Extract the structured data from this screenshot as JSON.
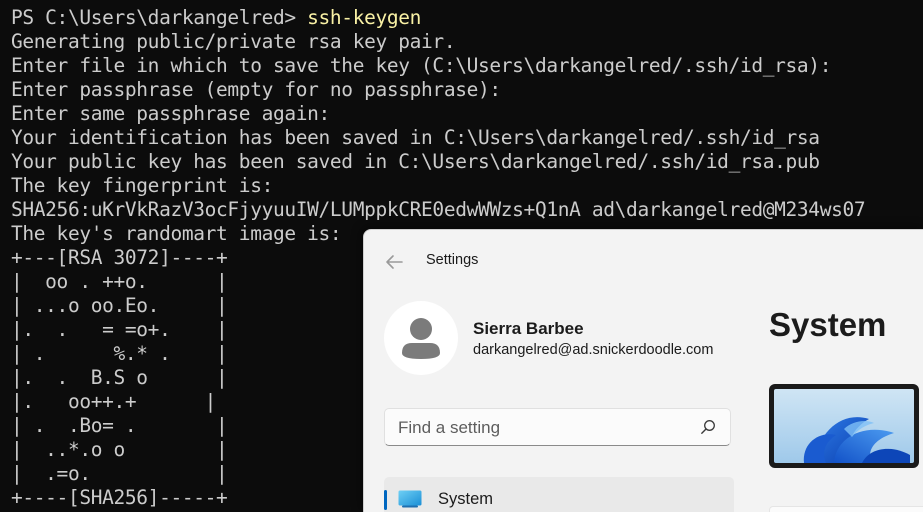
{
  "terminal": {
    "prompt": "PS C:\\Users\\darkangelred> ",
    "command": "ssh-keygen",
    "lines": [
      "Generating public/private rsa key pair.",
      "Enter file in which to save the key (C:\\Users\\darkangelred/.ssh/id_rsa):",
      "Enter passphrase (empty for no passphrase):",
      "Enter same passphrase again:",
      "Your identification has been saved in C:\\Users\\darkangelred/.ssh/id_rsa",
      "Your public key has been saved in C:\\Users\\darkangelred/.ssh/id_rsa.pub",
      "The key fingerprint is:",
      "SHA256:uKrVkRazV3ocFjyyuuIW/LUMppkCRE0edwWWzs+Q1nA ad\\darkangelred@M234ws07",
      "The key's randomart image is:",
      "+---[RSA 3072]----+",
      "|  oo . ++o.      |",
      "| ...o oo.Eo.     |",
      "|.  .   = =o+.    |",
      "| .      %.* .    |",
      "|.  .  B.S o      |",
      "|.   oo++.+      |",
      "| .  .Bo= .       |",
      "|  ..*.o o        |",
      "|  .=o.           |",
      "+----[SHA256]-----+"
    ],
    "colors": {
      "background": "#0c0c0c",
      "text": "#cccccc",
      "command": "#f9f1a5"
    }
  },
  "settings": {
    "back_icon": "back-arrow-icon",
    "title": "Settings",
    "user": {
      "avatar_icon": "person-icon",
      "name": "Sierra Barbee",
      "email": "darkangelred@ad.snickerdoodle.com"
    },
    "search": {
      "placeholder": "Find a setting",
      "icon": "search-icon"
    },
    "nav": [
      {
        "label": "System",
        "icon": "monitor-icon",
        "selected": true
      }
    ],
    "page_title": "System",
    "accent": "#0067c0"
  }
}
